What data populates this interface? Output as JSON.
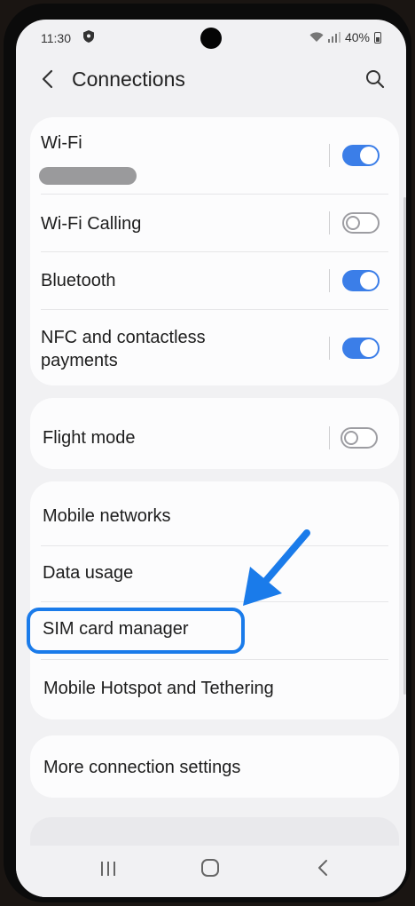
{
  "status_bar": {
    "time": "11:30",
    "battery": "40%"
  },
  "app_bar": {
    "title": "Connections"
  },
  "sections": {
    "wireless": {
      "wifi": {
        "label": "Wi-Fi",
        "enabled": true
      },
      "wifi_calling": {
        "label": "Wi-Fi Calling",
        "enabled": false
      },
      "bluetooth": {
        "label": "Bluetooth",
        "enabled": true
      },
      "nfc": {
        "label_line1": "NFC and contactless",
        "label_line2": "payments",
        "enabled": true
      }
    },
    "flight": {
      "label": "Flight mode",
      "enabled": false
    },
    "networks": {
      "items": [
        "Mobile networks",
        "Data usage",
        "SIM card manager",
        "Mobile Hotspot and Tethering"
      ]
    },
    "more": {
      "label": "More connection settings"
    }
  },
  "highlight": {
    "target": "SIM card manager",
    "color": "#1a7bea"
  },
  "colors": {
    "toggle_on": "#3b7ee8",
    "background": "#f1f1f3",
    "card": "#fcfcfd"
  },
  "nav_bar": {
    "icons": [
      "recent-apps-icon",
      "home-icon",
      "back-icon"
    ]
  }
}
